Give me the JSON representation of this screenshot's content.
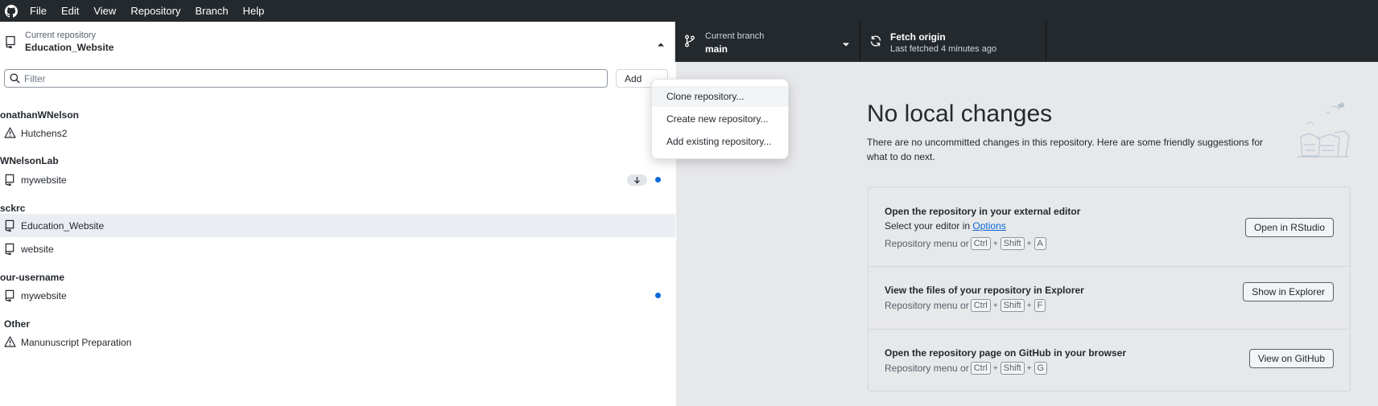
{
  "menubar": {
    "items": [
      "File",
      "Edit",
      "View",
      "Repository",
      "Branch",
      "Help"
    ]
  },
  "toolbar": {
    "repo": {
      "label": "Current repository",
      "value": "Education_Website"
    },
    "branch": {
      "label": "Current branch",
      "value": "main"
    },
    "fetch": {
      "label": "Fetch origin",
      "value": "Last fetched 4 minutes ago"
    }
  },
  "left": {
    "filter_placeholder": "Filter",
    "add_label": "Add",
    "groups": [
      {
        "header": "onathanWNelson",
        "repos": [
          {
            "name": "Hutchens2",
            "icon": "warning-icon"
          }
        ]
      },
      {
        "header": "WNelsonLab",
        "repos": [
          {
            "name": "mywebsite",
            "icon": "repo-icon",
            "behind": true,
            "changed": true
          }
        ]
      },
      {
        "header": "sckrc",
        "repos": [
          {
            "name": "Education_Website",
            "icon": "repo-icon",
            "selected": true
          },
          {
            "name": "website",
            "icon": "repo-icon"
          }
        ]
      },
      {
        "header": "our-username",
        "repos": [
          {
            "name": "mywebsite",
            "icon": "repo-icon",
            "changed": true
          }
        ]
      },
      {
        "header": "Other",
        "repos": [
          {
            "name": "Manunuscript Preparation",
            "icon": "warning-icon"
          }
        ]
      }
    ]
  },
  "dropdown": {
    "options": [
      "Clone repository...",
      "Create new repository...",
      "Add existing repository..."
    ]
  },
  "right": {
    "title": "No local changes",
    "description": "There are no uncommitted changes in this repository. Here are some friendly suggestions for what to do next.",
    "suggestions": [
      {
        "title": "Open the repository in your external editor",
        "line": "Select your editor in ",
        "link": "Options",
        "hint_prefix": "Repository menu or",
        "keys": [
          "Ctrl",
          "Shift",
          "A"
        ],
        "button": "Open in RStudio"
      },
      {
        "title": "View the files of your repository in Explorer",
        "hint_prefix": "Repository menu or",
        "keys": [
          "Ctrl",
          "Shift",
          "F"
        ],
        "button": "Show in Explorer"
      },
      {
        "title": "Open the repository page on GitHub in your browser",
        "hint_prefix": "Repository menu or",
        "keys": [
          "Ctrl",
          "Shift",
          "G"
        ],
        "button": "View on GitHub"
      }
    ],
    "plus_sign": "+"
  },
  "colors": {
    "accent": "#0969da",
    "dark": "#24292e",
    "panel": "#e7e8ea"
  }
}
